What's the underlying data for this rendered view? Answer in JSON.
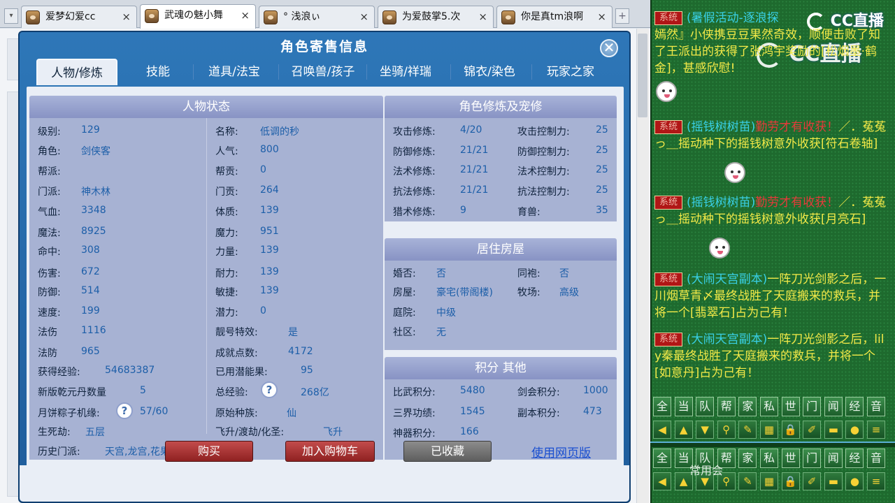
{
  "browser": {
    "tabs": [
      {
        "label": "爱梦幻爱cc",
        "active": false
      },
      {
        "label": "武魂の魅小舞",
        "active": true
      },
      {
        "label": "° 浅浪ぃ",
        "active": false
      },
      {
        "label": "为爱鼓掌5.次",
        "active": false
      },
      {
        "label": "你是真tm浪啊",
        "active": false
      }
    ],
    "close_glyph": "×",
    "new_tab_glyph": "+",
    "nav_glyph": "▾"
  },
  "dialog": {
    "title": "角色寄售信息",
    "close_glyph": "✕",
    "tabs": [
      "人物/修炼",
      "技能",
      "道具/法宝",
      "召唤兽/孩子",
      "坐骑/祥瑞",
      "锦衣/染色",
      "玩家之家"
    ],
    "active_tab": 0
  },
  "status": {
    "title": "人物状态",
    "left": [
      {
        "label": "级别:",
        "value": "129"
      },
      {
        "label": "角色:",
        "value": "剑侠客"
      },
      {
        "label": "帮派:",
        "value": ""
      },
      {
        "label": "门派:",
        "value": "神木林"
      },
      {
        "label": "气血:",
        "value": "3348"
      },
      {
        "label": "魔法:",
        "value": "8925"
      },
      {
        "label": "命中:",
        "value": "308"
      },
      {
        "label": "伤害:",
        "value": "672"
      },
      {
        "label": "防御:",
        "value": "514"
      },
      {
        "label": "速度:",
        "value": "199"
      },
      {
        "label": "法伤",
        "value": "1116"
      },
      {
        "label": "法防",
        "value": "965"
      },
      {
        "label": "获得经验:",
        "value": "54683387"
      },
      {
        "label": "新版乾元丹数量",
        "value": "5"
      },
      {
        "label": "月饼粽子机缘:",
        "value": "57/60"
      },
      {
        "label": "生死劫:",
        "value": "五层"
      },
      {
        "label": "历史门派:",
        "value": "天宫,龙宫,花果山,魔王寨"
      }
    ],
    "right": [
      {
        "label": "名称:",
        "value": "低调的秒"
      },
      {
        "label": "人气:",
        "value": "800"
      },
      {
        "label": "帮贡:",
        "value": "0"
      },
      {
        "label": "门贡:",
        "value": "264"
      },
      {
        "label": "体质:",
        "value": "139"
      },
      {
        "label": "魔力:",
        "value": "951"
      },
      {
        "label": "力量:",
        "value": "139"
      },
      {
        "label": "耐力:",
        "value": "139"
      },
      {
        "label": "敏捷:",
        "value": "139"
      },
      {
        "label": "潜力:",
        "value": "0"
      },
      {
        "label": "靓号特效:",
        "value": "是"
      },
      {
        "label": "成就点数:",
        "value": "4172"
      },
      {
        "label": "已用潜能果:",
        "value": "95"
      },
      {
        "label": "总经验:",
        "value": "268亿"
      },
      {
        "label": "原始种族:",
        "value": "仙"
      },
      {
        "label": "飞升/渡劫/化圣:",
        "value": "飞升"
      }
    ],
    "help_glyph": "?"
  },
  "cultivation": {
    "title": "角色修炼及宠修",
    "left": [
      {
        "label": "攻击修炼:",
        "value": "4/20"
      },
      {
        "label": "防御修炼:",
        "value": "21/21"
      },
      {
        "label": "法术修炼:",
        "value": "21/21"
      },
      {
        "label": "抗法修炼:",
        "value": "21/21"
      },
      {
        "label": "猎术修炼:",
        "value": "9"
      }
    ],
    "right": [
      {
        "label": "攻击控制力:",
        "value": "25"
      },
      {
        "label": "防御控制力:",
        "value": "25"
      },
      {
        "label": "法术控制力:",
        "value": "25"
      },
      {
        "label": "抗法控制力:",
        "value": "25"
      },
      {
        "label": "育兽:",
        "value": "35"
      }
    ]
  },
  "housing": {
    "title": "居住房屋",
    "rows": [
      {
        "label": "婚否:",
        "value": "否"
      },
      {
        "label": "房屋:",
        "value": "豪宅(带阁楼)"
      },
      {
        "label": "庭院:",
        "value": "中级"
      },
      {
        "label": "社区:",
        "value": "无"
      }
    ],
    "right": [
      {
        "label": "同袍:",
        "value": "否"
      },
      {
        "label": "牧场:",
        "value": "高级"
      }
    ]
  },
  "points": {
    "title": "积分 其他",
    "rows": [
      {
        "label": "比武积分:",
        "value": "5480"
      },
      {
        "label": "三界功绩:",
        "value": "1545"
      },
      {
        "label": "神器积分:",
        "value": "166"
      }
    ],
    "right": [
      {
        "label": "剑会积分:",
        "value": "1000"
      },
      {
        "label": "副本积分:",
        "value": "473"
      }
    ]
  },
  "footer": {
    "buy": "购买",
    "add_cart": "加入购物车",
    "favorited": "已收藏",
    "web_version": "使用网页版"
  },
  "chat": {
    "logo": "CC直播",
    "lines": [
      {
        "tag": "系统",
        "event": "(暑假活动-逐浪探",
        "text": "嫣然』小侠携豆豆果然奇效，顺便击败了知了王派出的",
        "extra": "获得了张鸿宇奖励的[松烟墨·鹤金]，甚感欣慰!"
      },
      {
        "tag": "系统",
        "event": "(摇钱树树苗)",
        "hot": "勤劳才有收获！",
        "text": "／．菟菟っ＿摇动种下的摇钱树意外收获[符石卷轴]"
      },
      {
        "tag": "系统",
        "event": "(摇钱树树苗)",
        "hot": "勤劳才有收获！",
        "text": "／．菟菟っ＿摇动种下的摇钱树意外收获[月亮石]"
      },
      {
        "tag": "系统",
        "event": "(大闹天宫副本)",
        "text": "一阵刀光剑影之后，一川烟草青〆最终战胜了天庭搬来的救兵，并将一个[翡翠石]占为己有！"
      },
      {
        "tag": "系统",
        "event": "(大闹天宫副本)",
        "text": "一阵刀光剑影之后，lily秦最终战胜了天庭搬来的救兵，并将一个[如意丹]占为己有！"
      }
    ],
    "channels": [
      "全",
      "当",
      "队",
      "帮",
      "家",
      "私",
      "世",
      "门",
      "闻",
      "经",
      "音"
    ],
    "tools": [
      "arrow-left-icon",
      "arrow-up-icon",
      "arrow-down-icon",
      "search-icon",
      "edit-icon",
      "grid-icon",
      "lock-icon",
      "brush-icon",
      "folder-icon",
      "chat-bubble-icon",
      "list-add-icon"
    ],
    "overlay": "常用会"
  },
  "colors": {
    "dialog_blue": "#2e77b8",
    "panel_header": "#8893c4",
    "value_blue": "#1c5ea8",
    "chat_green": "#1e6a2e",
    "chat_yellow": "#f2e948",
    "chat_cyan": "#39d0e6",
    "button_red": "#a33434"
  }
}
